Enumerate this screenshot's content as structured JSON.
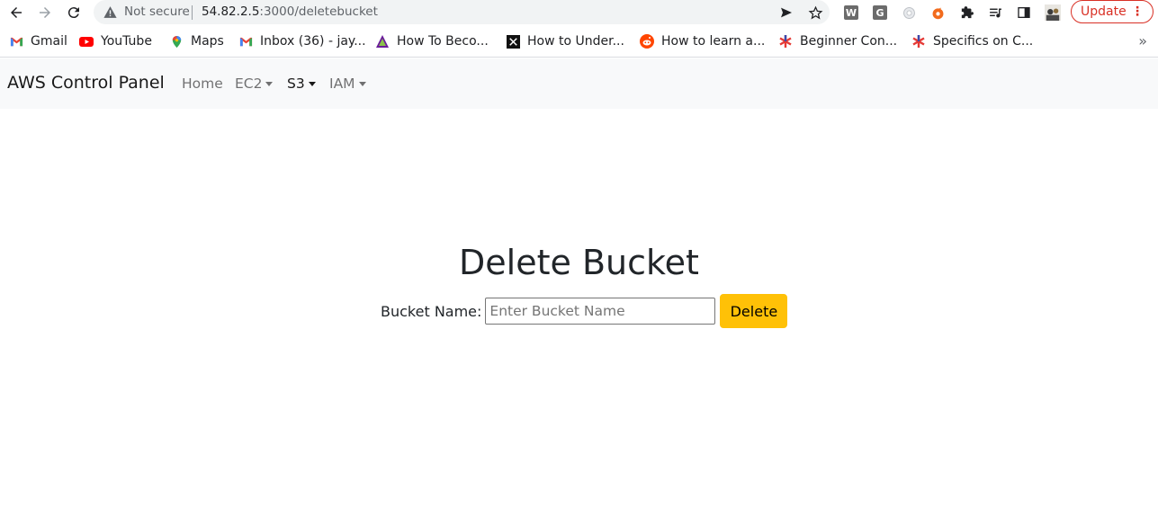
{
  "browser": {
    "security_label": "Not secure",
    "url_host": "54.82.2.5",
    "url_path": ":3000/deletebucket",
    "update_label": "Update",
    "extensions": [
      {
        "name": "W",
        "color": "#6b6b6b"
      },
      {
        "name": "G",
        "color": "#6b6b6b"
      }
    ]
  },
  "bookmarks": [
    {
      "label": "Gmail"
    },
    {
      "label": "YouTube"
    },
    {
      "label": "Maps"
    },
    {
      "label": "Inbox (36) - jay..."
    },
    {
      "label": "How To Beco..."
    },
    {
      "label": "How to Under..."
    },
    {
      "label": "How to learn a..."
    },
    {
      "label": "Beginner Con..."
    },
    {
      "label": "Specifics on C..."
    }
  ],
  "bookmarks_more": "»",
  "navbar": {
    "brand": "AWS Control Panel",
    "links": [
      {
        "label": "Home"
      },
      {
        "label": "EC2"
      },
      {
        "label": "S3"
      },
      {
        "label": "IAM"
      }
    ]
  },
  "main": {
    "title": "Delete Bucket",
    "bucket_label": "Bucket Name:",
    "bucket_placeholder": "Enter Bucket Name",
    "delete_label": "Delete"
  },
  "colors": {
    "accent_button": "#ffc107",
    "navbar_bg": "#f8f9fa",
    "update_red": "#d93025"
  }
}
